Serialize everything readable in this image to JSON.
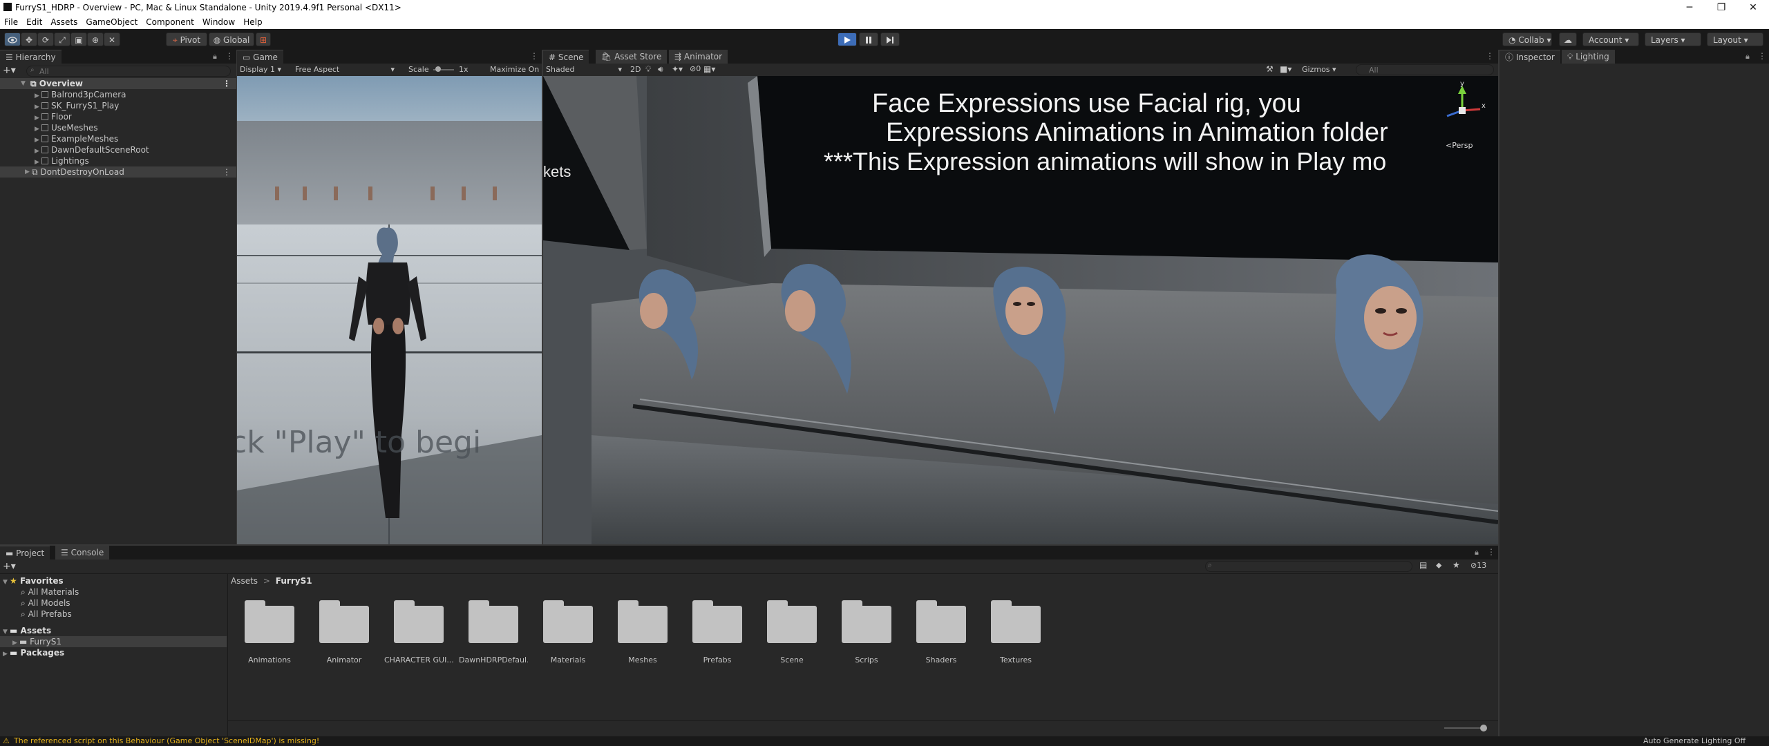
{
  "window": {
    "title": "FurryS1_HDRP - Overview - PC, Mac & Linux Standalone - Unity 2019.4.9f1 Personal <DX11>",
    "minimize": "─",
    "maximize": "❐",
    "close": "✕"
  },
  "menu": [
    "File",
    "Edit",
    "Assets",
    "GameObject",
    "Component",
    "Window",
    "Help"
  ],
  "toolbar": {
    "pivot": "Pivot",
    "global": "Global",
    "collab": "Collab",
    "account": "Account",
    "layers": "Layers",
    "layout": "Layout"
  },
  "hierarchy": {
    "tab": "Hierarchy",
    "search_placeholder": "All",
    "scene": "Overview",
    "items": [
      "Balrond3pCamera",
      "SK_FurryS1_Play",
      "Floor",
      "UseMeshes",
      "ExampleMeshes",
      "DawnDefaultSceneRoot",
      "Lightings"
    ],
    "dont_destroy": "DontDestroyOnLoad"
  },
  "game": {
    "tab": "Game",
    "display": "Display 1",
    "aspect": "Free Aspect",
    "scale_label": "Scale",
    "scale_value": "1x",
    "maximize": "Maximize On",
    "floor_text": "ck \"Play\" to begi"
  },
  "scene": {
    "tabs": [
      "Scene",
      "Asset Store",
      "Animator"
    ],
    "shading": "Shaded",
    "mode2d": "2D",
    "fx_count": "0",
    "gizmos": "Gizmos",
    "search_placeholder": "All",
    "sign_lines": [
      "Face Expressions use Facial rig, you",
      "Expressions Animations in Animation folder",
      "***This Expression animations will show in Play mo"
    ],
    "left_board": "kets",
    "persp": "<Persp",
    "axis_y": "y",
    "axis_x": "x"
  },
  "inspector": {
    "tabs": [
      "Inspector",
      "Lighting"
    ]
  },
  "project": {
    "tabs": [
      "Project",
      "Console"
    ],
    "favorites": "Favorites",
    "fav_items": [
      "All Materials",
      "All Models",
      "All Prefabs"
    ],
    "assets": "Assets",
    "asset_child": "FurryS1",
    "packages": "Packages",
    "breadcrumb": [
      "Assets",
      "FurryS1"
    ],
    "breadcrumb_sep": ">",
    "hidden_count": "13",
    "folders": [
      "Animations",
      "Animator",
      "CHARACTER GUI...",
      "DawnHDRPDefaul...",
      "Materials",
      "Meshes",
      "Prefabs",
      "Scene",
      "Scrips",
      "Shaders",
      "Textures"
    ]
  },
  "status": {
    "warning": "The referenced script on this Behaviour (Game Object 'SceneIDMap') is missing!",
    "right": "Auto Generate Lighting Off"
  },
  "colors": {
    "accent_blue": "#46607c",
    "play_active": "#3d6db8",
    "warning": "#e6b21a",
    "panel_bg": "#282828"
  }
}
